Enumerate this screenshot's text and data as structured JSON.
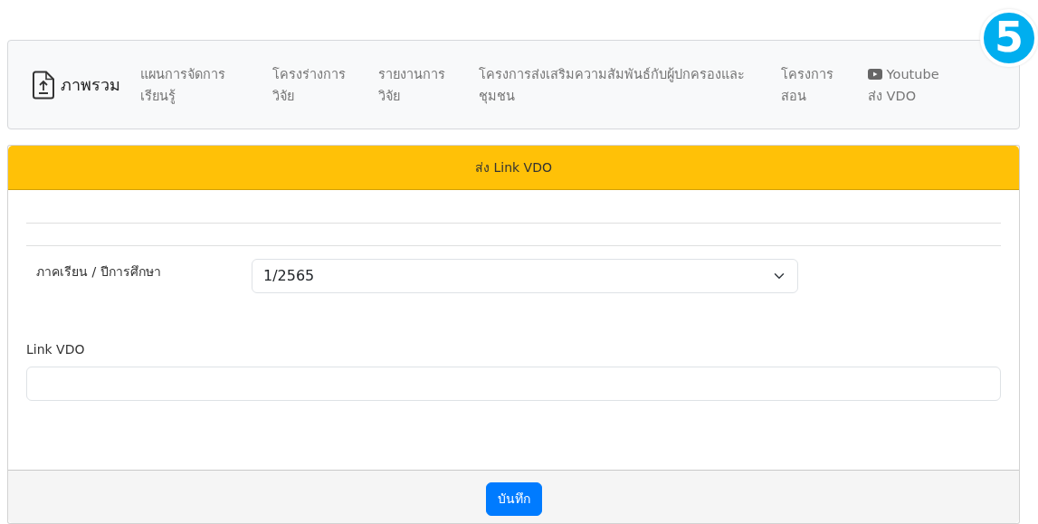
{
  "navbar": {
    "brand": "ภาพรวม",
    "items": [
      {
        "label": "แผนการจัดการเรียนรู้",
        "kind": "text"
      },
      {
        "label": "โครงร่างการวิจัย",
        "kind": "text"
      },
      {
        "label": "รายงานการวิจัย",
        "kind": "text"
      },
      {
        "label": "โครงการส่งเสริมความสัมพันธ์กับผู้ปกครองและชุมชน",
        "kind": "text"
      },
      {
        "label": "โครงการสอน",
        "kind": "text"
      },
      {
        "label": "Youtube ส่ง VDO",
        "kind": "video"
      }
    ]
  },
  "step_badge": "5",
  "card": {
    "header": "ส่ง Link VDO",
    "term_field": {
      "label": "ภาคเรียน / ปีการศึกษา",
      "value": "1/2565"
    },
    "link_field": {
      "label": "Link VDO"
    },
    "save_button": "บันทึก"
  }
}
